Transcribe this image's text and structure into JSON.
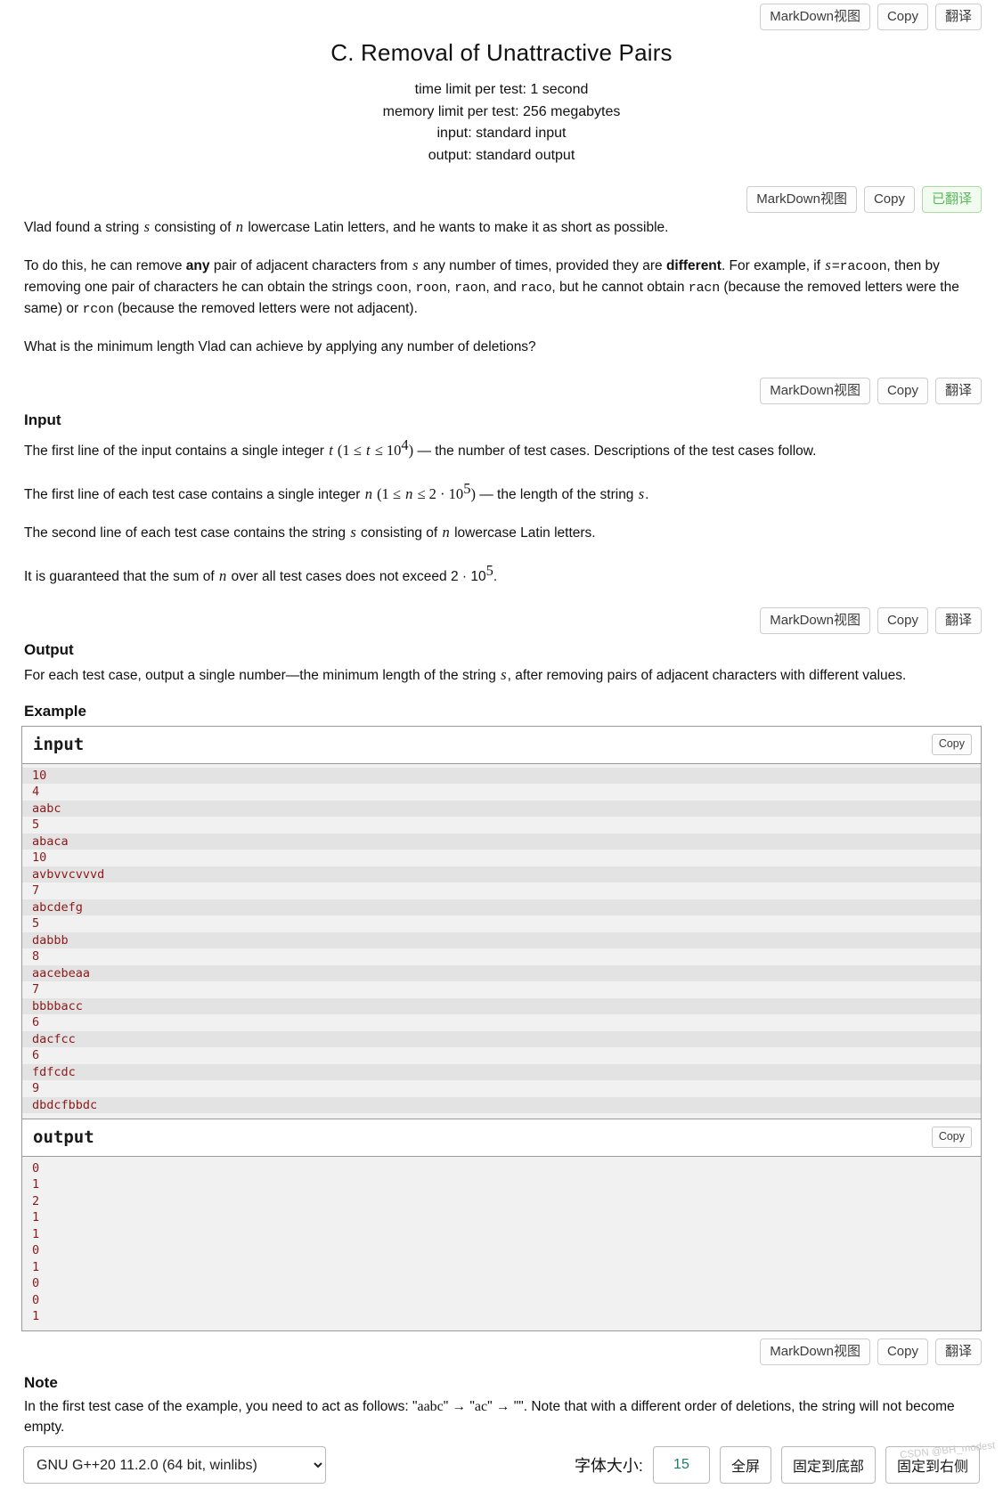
{
  "toolbars": {
    "top": {
      "markdown": "MarkDown视图",
      "copy": "Copy",
      "translate": "翻译"
    },
    "statement": {
      "markdown": "MarkDown视图",
      "copy": "Copy",
      "translate": "已翻译"
    },
    "input": {
      "markdown": "MarkDown视图",
      "copy": "Copy",
      "translate": "翻译"
    },
    "output": {
      "markdown": "MarkDown视图",
      "copy": "Copy",
      "translate": "翻译"
    },
    "note": {
      "markdown": "MarkDown视图",
      "copy": "Copy",
      "translate": "翻译"
    }
  },
  "header": {
    "title": "C. Removal of Unattractive Pairs",
    "time_limit": "time limit per test: 1 second",
    "memory_limit": "memory limit per test: 256 megabytes",
    "input_spec": "input: standard input",
    "output_spec": "output: standard output"
  },
  "statement": {
    "p1_a": "Vlad found a string ",
    "p1_s": "s",
    "p1_b": " consisting of ",
    "p1_n": "n",
    "p1_c": " lowercase Latin letters, and he wants to make it as short as possible.",
    "p2_a": "To do this, he can remove ",
    "p2_any": "any",
    "p2_b": " pair of adjacent characters from ",
    "p2_s": "s",
    "p2_c": " any number of times, provided they are ",
    "p2_diff": "different",
    "p2_d": ". For example, if ",
    "p2_s2": "s",
    "p2_e": "=",
    "p2_racoon": "racoon",
    "p2_f": ", then by removing one pair of characters he can obtain the strings ",
    "p2_w1": "coon",
    "p2_w2": "roon",
    "p2_w3": "raon",
    "p2_and": ", and ",
    "p2_w4": "raco",
    "p2_g": ", but he cannot obtain ",
    "p2_racn": "racn",
    "p2_h": " (because the removed letters were the same) or ",
    "p2_rcon": "rcon",
    "p2_i": " (because the removed letters were not adjacent).",
    "p3": "What is the minimum length Vlad can achieve by applying any number of deletions?"
  },
  "input_section": {
    "heading": "Input",
    "l1_a": "The first line of the input contains a single integer ",
    "l1_t": "t",
    "l1_range_open": " (1 ≤ ",
    "l1_t2": "t",
    "l1_le": " ≤ 10",
    "l1_exp": "4",
    "l1_close": ")",
    "l1_b": " — the number of test cases. Descriptions of the test cases follow.",
    "l2_a": "The first line of each test case contains a single integer ",
    "l2_n": "n",
    "l2_range_open": " (1 ≤ ",
    "l2_n2": "n",
    "l2_le": " ≤ 2 · 10",
    "l2_exp": "5",
    "l2_close": ")",
    "l2_b": " — the length of the string ",
    "l2_s": "s",
    "l2_c": ".",
    "l3_a": "The second line of each test case contains the string ",
    "l3_s": "s",
    "l3_b": " consisting of ",
    "l3_n": "n",
    "l3_c": " lowercase Latin letters.",
    "l4_a": "It is guaranteed that the sum of ",
    "l4_n": "n",
    "l4_b": " over all test cases does not exceed 2 · 10",
    "l4_exp": "5",
    "l4_c": "."
  },
  "output_section": {
    "heading": "Output",
    "l1_a": "For each test case, output a single number—the minimum length of the string ",
    "l1_s": "s",
    "l1_b": ", after removing pairs of adjacent characters with different values."
  },
  "example": {
    "heading": "Example",
    "input_label": "input",
    "output_label": "output",
    "copy_label": "Copy",
    "input_lines": [
      "10",
      "4",
      "aabc",
      "5",
      "abaca",
      "10",
      "avbvvcvvvd",
      "7",
      "abcdefg",
      "5",
      "dabbb",
      "8",
      "aacebeaa",
      "7",
      "bbbbacc",
      "6",
      "dacfcc",
      "6",
      "fdfcdc",
      "9",
      "dbdcfbbdc"
    ],
    "output_lines": [
      "0",
      "1",
      "2",
      "1",
      "1",
      "0",
      "1",
      "0",
      "0",
      "1"
    ]
  },
  "note_section": {
    "heading": "Note",
    "l1_a": "In the first test case of the example, you need to act as follows: \"",
    "l1_w1": "aabc",
    "l1_arrow1": "\" → \"",
    "l1_w2": "ac",
    "l1_arrow2": "\" → \"\". Note that with a different order of deletions, the string will not become empty."
  },
  "bottom_bar": {
    "compiler": "GNU G++20 11.2.0 (64 bit, winlibs)",
    "font_size_label": "字体大小:",
    "font_size_value": "15",
    "fullscreen": "全屏",
    "pin_bottom": "固定到底部",
    "pin_right": "固定到右侧"
  },
  "watermark": "CSDN @BH_modest"
}
